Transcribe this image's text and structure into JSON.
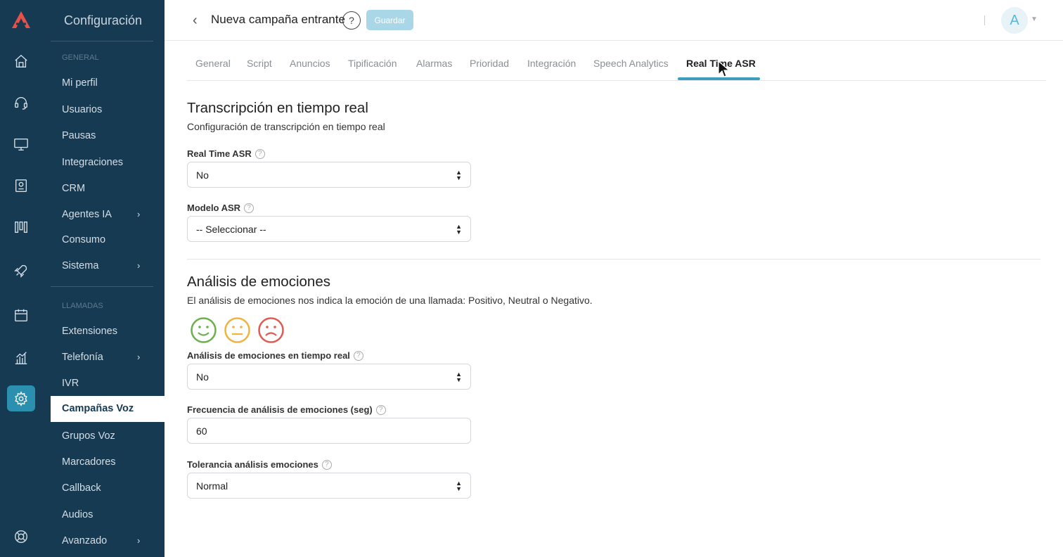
{
  "rail": {
    "icons": [
      "logo-icon",
      "home-icon",
      "headset-icon",
      "monitor-icon",
      "badge-icon",
      "board-icon",
      "rocket-icon",
      "calendar-icon",
      "chart-icon",
      "gear-icon",
      "lifebuoy-icon"
    ],
    "active": "gear-icon"
  },
  "menu": {
    "title": "Configuración",
    "sections": [
      {
        "label": "GENERAL",
        "items": [
          "Mi perfil",
          "Usuarios",
          "Pausas",
          "Integraciones",
          "CRM",
          "Agentes IA",
          "Consumo",
          "Sistema"
        ]
      },
      {
        "label": "LLAMADAS",
        "items": [
          "Extensiones",
          "Telefonía",
          "IVR",
          "Campañas Voz",
          "Grupos Voz",
          "Marcadores",
          "Callback",
          "Audios",
          "Avanzado"
        ]
      }
    ],
    "active": "Campañas Voz"
  },
  "header": {
    "title": "Nueva campaña entrante",
    "help": "?",
    "save_label": "Guardar",
    "avatar": "A"
  },
  "tabs": [
    "General",
    "Script",
    "Anuncios",
    "Tipificación",
    "Alarmas",
    "Prioridad",
    "Integración",
    "Speech Analytics",
    "Real Time ASR"
  ],
  "active_tab": "Real Time ASR",
  "asr": {
    "heading": "Transcripción en tiempo real",
    "sub": "Configuración de transcripción en tiempo real",
    "field1_label": "Real Time ASR",
    "field1_value": "No",
    "field2_label": "Modelo ASR",
    "field2_value": "-- Seleccionar --"
  },
  "emotions": {
    "heading": "Análisis de emociones",
    "sub": "El análisis de emociones nos indica la emoción de una llamada: Positivo, Neutral o Negativo.",
    "faces": [
      {
        "name": "positive",
        "color": "#6ab04c"
      },
      {
        "name": "neutral",
        "color": "#f0b33b"
      },
      {
        "name": "negative",
        "color": "#e05a4f"
      }
    ],
    "field1_label": "Análisis de emociones en tiempo real",
    "field1_value": "No",
    "field2_label": "Frecuencia de análisis de emociones (seg)",
    "field2_value": "60",
    "field3_label": "Tolerancia análisis emociones",
    "field3_value": "Normal"
  },
  "colors": {
    "sidebar": "#163a52",
    "accent": "#3c9dbd",
    "logo": "#e8504a"
  }
}
